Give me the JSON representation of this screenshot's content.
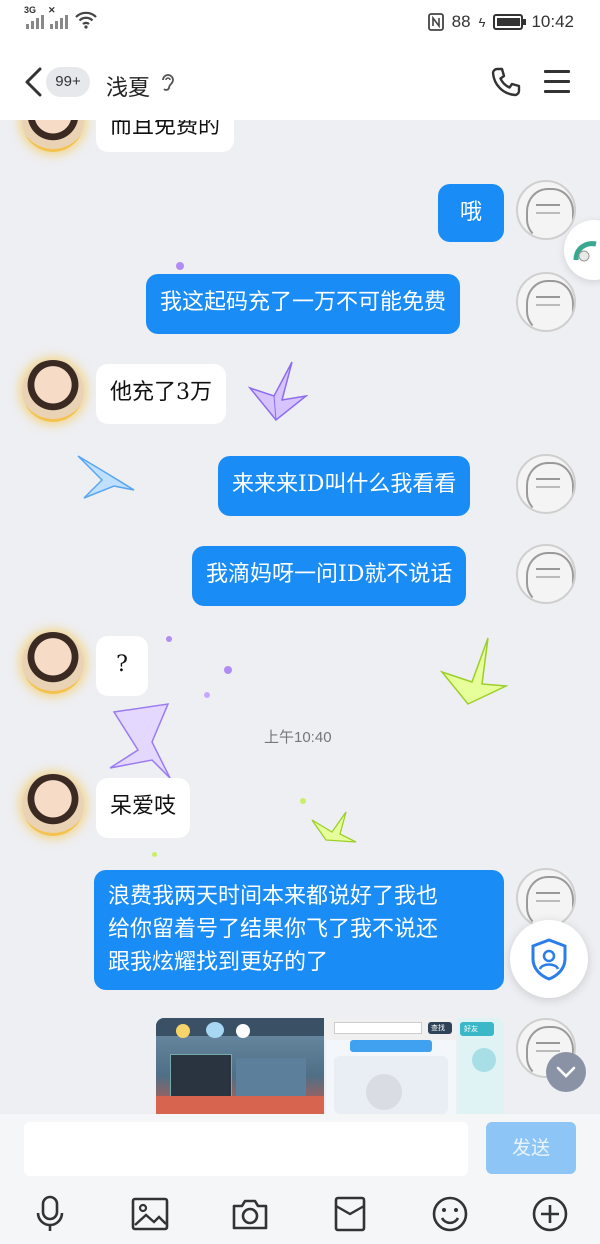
{
  "status_bar": {
    "network_left": "3G",
    "network_right": "4G",
    "battery": "88",
    "battery_level": 0.88,
    "time": "10:42"
  },
  "header": {
    "unread_badge": "99+",
    "title": "浅夏",
    "back_icon": "chevron-left-icon",
    "ear_icon": "hearing-icon",
    "call_icon": "phone-icon",
    "menu_icon": "menu-icon"
  },
  "messages": [
    {
      "side": "in",
      "text": "而且免费的"
    },
    {
      "side": "out",
      "text": "哦"
    },
    {
      "side": "out",
      "text": "我这起码充了一万不可能免费"
    },
    {
      "side": "in",
      "text": "他充了3万"
    },
    {
      "side": "out",
      "text": "来来来ID叫什么我看看"
    },
    {
      "side": "out",
      "text": "我滴妈呀一问ID就不说话"
    },
    {
      "side": "in",
      "text": "?"
    },
    {
      "side": "in",
      "text": "呆爱吱"
    },
    {
      "side": "out",
      "lines": [
        "浪费我两天时间本来都说好了我也",
        "给你留着号了结果你飞了我不说还",
        "跟我炫耀找到更好的了"
      ]
    }
  ],
  "timestamp": "上午10:40",
  "image_message": {
    "panel2_button": "查找",
    "panel3_title": "好友"
  },
  "input": {
    "placeholder": "",
    "send_label": "发送"
  },
  "toolbar": [
    "microphone-icon",
    "image-icon",
    "camera-icon",
    "red-packet-icon",
    "emoji-icon",
    "plus-icon"
  ],
  "colors": {
    "outgoing_bubble": "#1a8cf5",
    "incoming_bubble": "#ffffff",
    "chat_background": "#eeeff3",
    "send_button": "#8dc6f6"
  }
}
